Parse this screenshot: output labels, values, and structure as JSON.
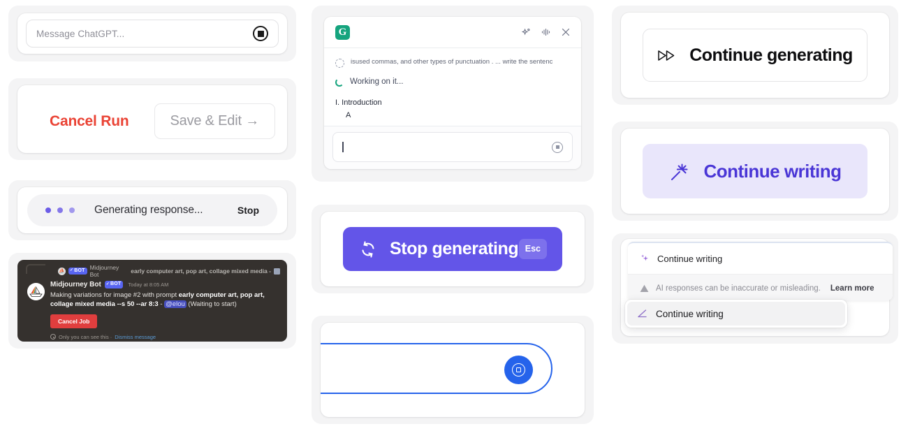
{
  "chatgpt_card": {
    "input": {
      "placeholder": "Message ChatGPT...",
      "value": ""
    },
    "stop_button_icon": "stop-square-icon"
  },
  "cancel_run_card": {
    "cancel_label": "Cancel Run",
    "save_label": "Save & Edit →"
  },
  "generating_card": {
    "status_label": "Generating response...",
    "stop_label": "Stop",
    "dot_color": "#6b5ce7"
  },
  "discord_card": {
    "reply_preview": {
      "author": "Midjourney Bot",
      "bot_tag": "BOT",
      "text": "early computer art, pop art, collage mixed media -",
      "attachment_icon": "image-icon"
    },
    "author": "Midjourney Bot",
    "bot_tag": "BOT",
    "timestamp": "Today at 8:05 AM",
    "message_parts": {
      "lead": "Making variations for image #2 with prompt ",
      "prompt": "early computer art, pop art, collage mixed media --s 50 --ar 8:3",
      "dash": " - ",
      "mention": "@elou",
      "trail": " (Waiting to start)"
    },
    "cancel_job_label": "Cancel Job",
    "footer_text": "Only you can see this · ",
    "footer_link": "Dismiss message",
    "accent": "#e03e3e"
  },
  "grammarly_card": {
    "logo_letter": "G",
    "logo_color": "#15a47e",
    "header_icons": [
      "sparkle-icon",
      "waveform-icon",
      "close-icon"
    ],
    "suggestion": "isused commas, and other types of punctuation . ... write the sentenc",
    "working_label": "Working on it...",
    "outline": [
      "I. Introduction",
      "A"
    ],
    "input": {
      "value": "",
      "placeholder": ""
    },
    "send_icon": "stop-square-icon"
  },
  "stop_generating_card": {
    "label": "Stop generating",
    "shortcut": "Esc",
    "icon": "refresh-stop-icon",
    "bg_color": "#6355e8"
  },
  "blue_input_card": {
    "input_value": "",
    "send_icon": "stop-square-icon",
    "accent": "#2563eb"
  },
  "continue_generating_card": {
    "label": "Continue generating",
    "icon": "fast-forward-icon"
  },
  "continue_writing_card": {
    "label": "Continue writing",
    "icon": "magic-wand-icon",
    "bg_color": "#e9e6fb",
    "text_color": "#4a36d6"
  },
  "menus_card": {
    "item_label": "Continue writing",
    "item_icon": "sparkles-icon",
    "disclaimer_icon": "warning-icon",
    "disclaimer_text": "AI responses can be inaccurate or misleading.",
    "learn_more_label": "Learn more",
    "overlay_label": "Continue writing",
    "overlay_icon": "angle-pen-icon"
  }
}
